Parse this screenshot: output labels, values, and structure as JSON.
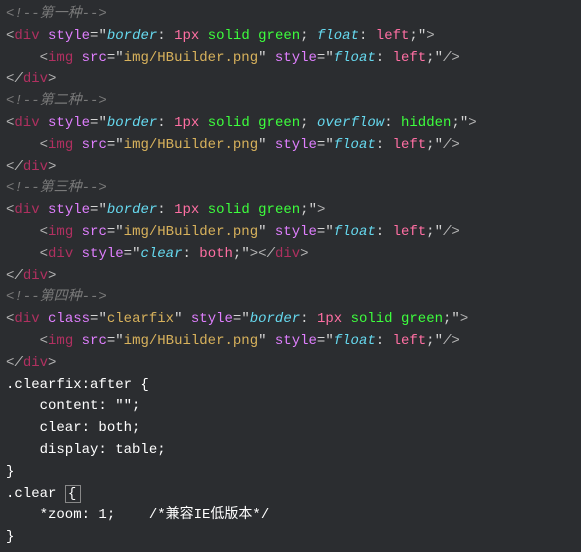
{
  "c1": "<!--第一种-->",
  "c2": "<!--第二种-->",
  "c3": "<!--第三种-->",
  "c4": "<!--第四种-->",
  "div": "div",
  "img": "img",
  "style_attr": "style",
  "class_attr": "class",
  "src_attr": "src",
  "border": "border",
  "float": "float",
  "overflow": "overflow",
  "clear": "clear",
  "px1": "1px",
  "green": "green",
  "left": "left",
  "hidden": "hidden",
  "both": "both",
  "solid": "solid",
  "imgpath": "img/HBuilder.png",
  "clearfix": "clearfix",
  "css_sel": ".clearfix:after {",
  "css_l1": "    content: \"\";",
  "css_l2": "    clear: both;",
  "css_l3": "    display: table;",
  "css_close": "}",
  "clear_sel": ".clear ",
  "open_brace": "{",
  "zoom": "    *zoom: 1;    /*兼容IE低版本*/",
  "final": "}"
}
